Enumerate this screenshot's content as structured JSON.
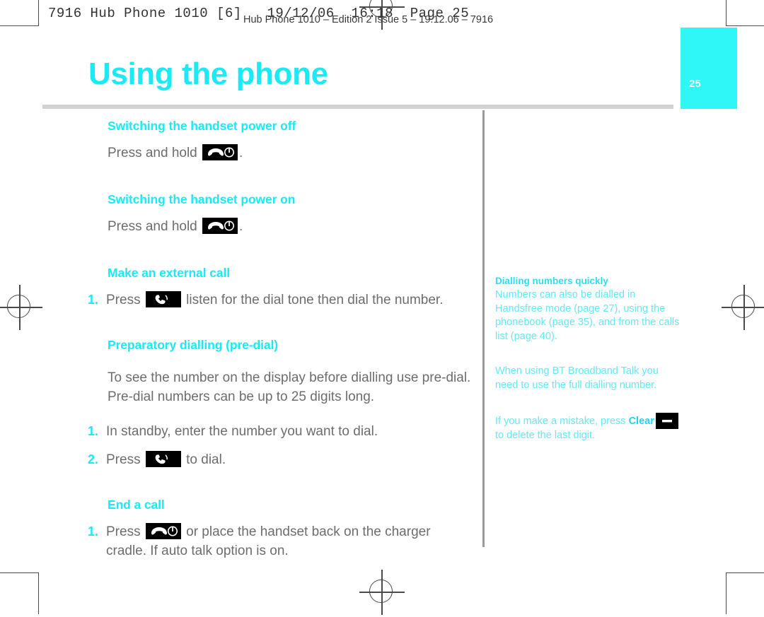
{
  "print_marks": {
    "header_line": "7916 Hub Phone 1010 [6]   19/12/06  16:18  Page 25",
    "running_head": "Hub Phone 1010 – Edition 2 Issue 5 – 19.12.06 – 7916"
  },
  "page": {
    "title": "Using the phone",
    "page_number": "25",
    "accent_color": "#19eaf5",
    "tab_color": "#2ff7f7",
    "body_color": "#6d6d6d"
  },
  "main": {
    "sections": [
      {
        "heading": "Switching the handset power off",
        "lines": [
          {
            "pre": "Press and hold ",
            "icon": "end-call-power-key",
            "post": "."
          }
        ]
      },
      {
        "heading": "Switching the handset power on",
        "lines": [
          {
            "pre": "Press and hold ",
            "icon": "end-call-power-key",
            "post": "."
          }
        ]
      },
      {
        "heading": "Make an external call",
        "items": [
          {
            "marker": "1.",
            "pre": "Press ",
            "icon": "call-key",
            "post": " listen for the dial tone then dial the number."
          }
        ]
      },
      {
        "heading": "Preparatory dialling (pre-dial)",
        "paragraph": "To see the number on the display before dialling use pre-dial. Pre-dial numbers can be up to 25 digits long.",
        "items": [
          {
            "marker": "1.",
            "pre": "In standby, enter the number you want to dial.",
            "icon": "",
            "post": ""
          },
          {
            "marker": "2.",
            "pre": "Press ",
            "icon": "call-key",
            "post": " to dial."
          }
        ]
      },
      {
        "heading": "End a call",
        "items": [
          {
            "marker": "1.",
            "pre": "Press ",
            "icon": "end-call-power-key",
            "post": " or place the handset back on the charger cradle. If auto talk option is on."
          }
        ]
      }
    ]
  },
  "sidebar": {
    "blocks": [
      {
        "heading": "Dialling numbers quickly",
        "text": "Numbers can also be dialled in Handsfree mode (page 27), using the phonebook (page 35), and from the calls list (page 40)."
      },
      {
        "heading": "",
        "text": "When using BT Broadband Talk you need to use the full dialling number."
      },
      {
        "heading": "",
        "text_pre": "If you make a mistake, press ",
        "strong": "Clear",
        "icon": "clear-key",
        "text_post": "to delete the last digit."
      }
    ]
  }
}
